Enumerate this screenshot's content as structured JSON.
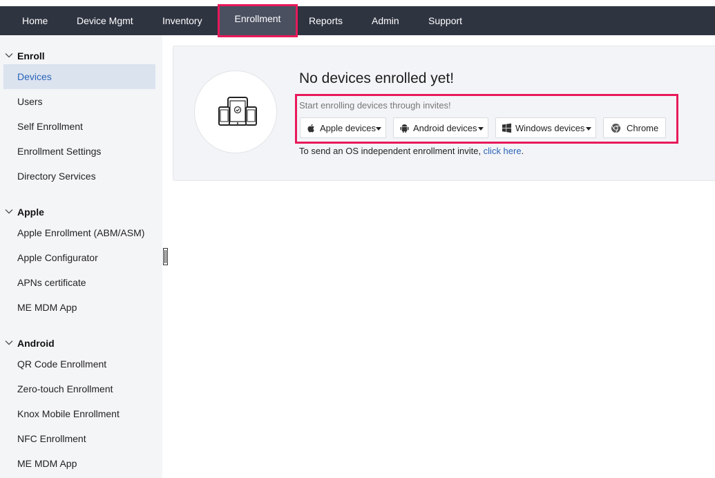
{
  "nav": {
    "items": [
      {
        "label": "Home"
      },
      {
        "label": "Device Mgmt"
      },
      {
        "label": "Inventory"
      },
      {
        "label": "Enrollment"
      },
      {
        "label": "Reports"
      },
      {
        "label": "Admin"
      },
      {
        "label": "Support"
      }
    ],
    "active": "Enrollment"
  },
  "sidebar": {
    "sections": [
      {
        "title": "Enroll",
        "items": [
          "Devices",
          "Users",
          "Self Enrollment",
          "Enrollment Settings",
          "Directory Services"
        ]
      },
      {
        "title": "Apple",
        "items": [
          "Apple Enrollment (ABM/ASM)",
          "Apple Configurator",
          "APNs certificate",
          "ME MDM App"
        ]
      },
      {
        "title": "Android",
        "items": [
          "QR Code Enrollment",
          "Zero-touch Enrollment",
          "Knox Mobile Enrollment",
          "NFC Enrollment",
          "ME MDM App"
        ]
      }
    ],
    "active_item": "Devices"
  },
  "empty_state": {
    "icon": "devices-icon",
    "title": "No devices enrolled yet!",
    "subtitle": "Start enrolling devices through invites!",
    "buttons": [
      {
        "label": "Apple devices",
        "icon": "apple-icon",
        "dropdown": true
      },
      {
        "label": "Android devices",
        "icon": "android-icon",
        "dropdown": true
      },
      {
        "label": "Windows devices",
        "icon": "windows-icon",
        "dropdown": true
      },
      {
        "label": "Chrome",
        "icon": "chrome-icon",
        "dropdown": false
      }
    ],
    "note_prefix": "To send an OS independent enrollment invite, ",
    "note_link": "click here",
    "note_suffix": "."
  },
  "colors": {
    "topbar": "#2f3441",
    "highlight": "#e8195a",
    "link": "#2a64b8",
    "active_sidebar_bg": "#dbe3ef"
  }
}
